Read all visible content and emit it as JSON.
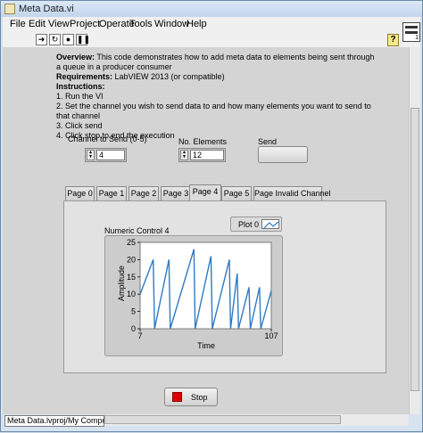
{
  "window": {
    "title": "Meta Data.vi"
  },
  "menu": [
    "File",
    "Edit",
    "View",
    "Project",
    "Operate",
    "Tools",
    "Window",
    "Help"
  ],
  "toolbar": {
    "help_glyph": "?"
  },
  "vi_icon": {
    "label": "1"
  },
  "description": {
    "overview_label": "Overview:",
    "overview_text": " This code demonstrates how to add meta data to elements being sent through a queue in a producer consumer",
    "requirements_label": "Requirements:",
    "requirements_text": " LabVIEW 2013 (or compatible)",
    "instructions_label": "Instructions:",
    "steps": [
      "1. Run the VI",
      "2. Set the channel you wish to send data to and how many elements you want to send to that channel",
      "3. Click send",
      "4. Click stop to end the execution"
    ]
  },
  "controls": {
    "channel_label": "Channel to Send (0-5)",
    "channel_value": "4",
    "elements_label": "No. Elements",
    "elements_value": "12",
    "send_label": "Send"
  },
  "tabs": {
    "active": 4,
    "items": [
      "Page 0",
      "Page 1",
      "Page 2",
      "Page 3",
      "Page 4",
      "Page 5",
      "Page Invalid Channel"
    ]
  },
  "graph": {
    "legend_label": "Plot 0",
    "line_color": "#2f7ac4"
  },
  "chart_data": {
    "type": "line",
    "title": "Numeric Control 4",
    "xlabel": "Time",
    "ylabel": "Amplitude",
    "xlim": [
      7,
      107
    ],
    "ylim": [
      0,
      25
    ],
    "x_ticks": [
      7,
      107
    ],
    "y_ticks": [
      0,
      5,
      10,
      15,
      20,
      25
    ],
    "series": [
      {
        "name": "Plot 0",
        "x": [
          7,
          17,
          18,
          29,
          30,
          48,
          49,
          61,
          62,
          75,
          76,
          81,
          82,
          90,
          91,
          98,
          99,
          107
        ],
        "y": [
          10,
          20,
          0,
          20,
          0,
          23,
          0,
          21,
          0,
          20,
          0,
          16,
          0,
          12,
          0,
          12,
          0,
          11
        ]
      }
    ]
  },
  "stop": {
    "label": "Stop"
  },
  "status": {
    "path": "Meta Data.lvproj/My Computer"
  }
}
